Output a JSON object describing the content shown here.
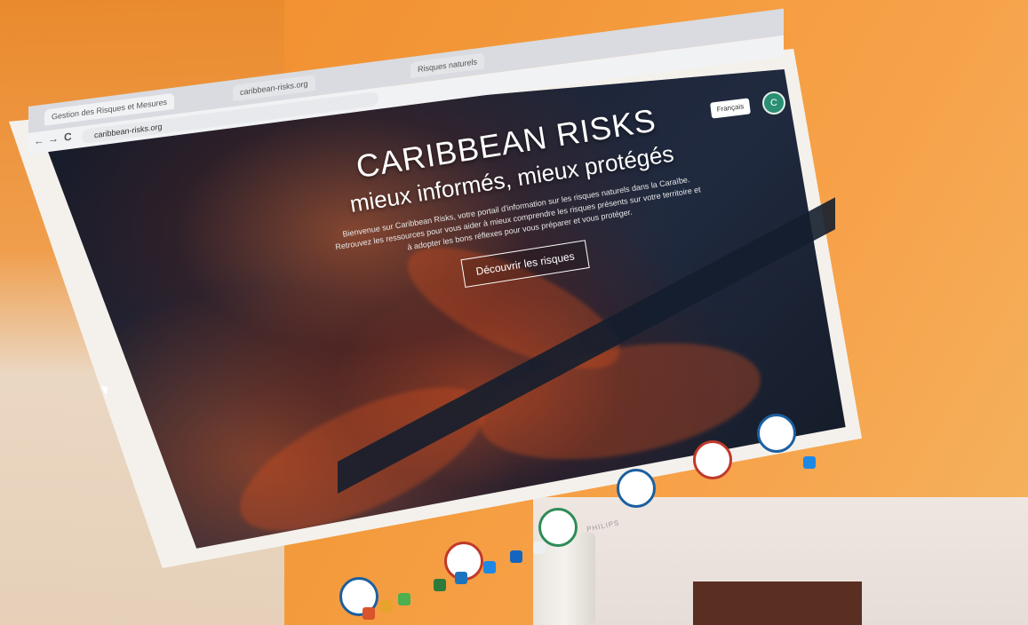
{
  "browser": {
    "tabs": [
      "Gestion des Risques et Mesures",
      "caribbean-risks.org",
      "Risques naturels"
    ],
    "url": "caribbean-risks.org",
    "nav": {
      "back": "←",
      "forward": "→",
      "reload": "C",
      "lock": "🔒"
    }
  },
  "header": {
    "lang_label": "Français",
    "profile_initial": "C"
  },
  "hero": {
    "title": "CARIBBEAN RISKS",
    "subtitle": "mieux informés, mieux protégés",
    "description": "Bienvenue sur Caribbean Risks, votre portail d'information sur les risques naturels dans la Caraïbe. Retrouvez les ressources pour vous aider à mieux comprendre les risques présents sur votre territoire et à adopter les bons réflexes pour vous préparer et vous protéger.",
    "cta_label": "Découvrir les risques"
  },
  "monitor": {
    "brand": "PHILIPS"
  },
  "colors": {
    "accent": "#1c5fa0",
    "profile": "#2a8f74",
    "lava": "#dc5020"
  },
  "risk_icons": [
    {
      "name": "cyclone-icon",
      "color": "#1c5fa0"
    },
    {
      "name": "volcano-icon",
      "color": "#c0392b"
    },
    {
      "name": "vegetation-icon",
      "color": "#2e8b57"
    },
    {
      "name": "house-icon",
      "color": "#1c5fa0"
    },
    {
      "name": "no-entry-icon",
      "color": "#c0392b"
    },
    {
      "name": "wave-icon",
      "color": "#1c5fa0"
    }
  ]
}
